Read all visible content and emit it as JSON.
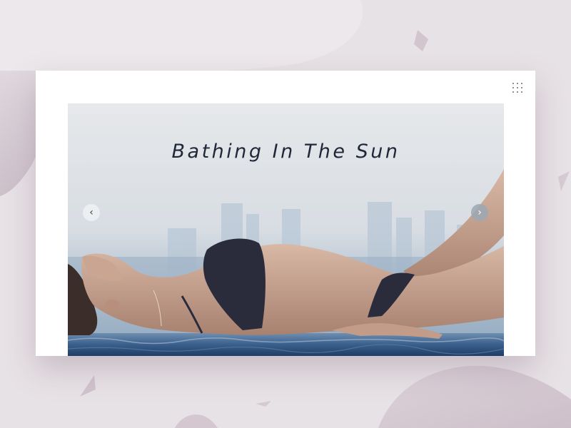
{
  "slider": {
    "title": "Bathing In The Sun",
    "prev_icon": "‹",
    "next_icon": "›"
  },
  "icons": {
    "menu": "grid-dots-icon",
    "prev": "chevron-left-icon",
    "next": "chevron-right-icon"
  },
  "colors": {
    "background": "#e7e2e6",
    "card": "#ffffff",
    "title": "#1f2738",
    "water": "#3a5f8c"
  }
}
